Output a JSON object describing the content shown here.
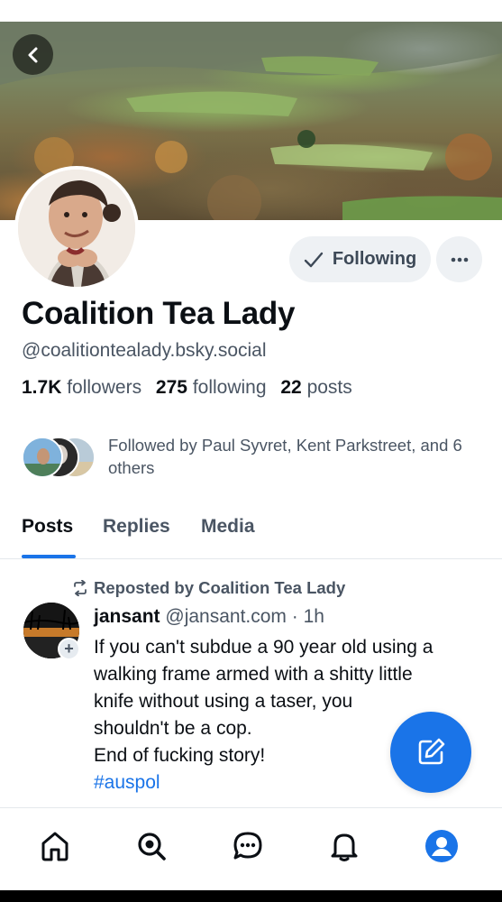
{
  "profile": {
    "display_name": "Coalition Tea Lady",
    "handle": "@coalitiontealady.bsky.social",
    "followers_count": "1.7K",
    "followers_label": "followers",
    "following_count": "275",
    "following_label": "following",
    "posts_count": "22",
    "posts_label": "posts",
    "following_button_label": "Following",
    "followed_by_text": "Followed by Paul Syvret, Kent Parkstreet, and 6 others"
  },
  "tabs": [
    {
      "label": "Posts",
      "active": true
    },
    {
      "label": "Replies",
      "active": false
    },
    {
      "label": "Media",
      "active": false
    }
  ],
  "feed": [
    {
      "repost_label": "Reposted by Coalition Tea Lady",
      "author": "jansant",
      "handle": "@jansant.com",
      "separator": "·",
      "time": "1h",
      "body_lines": [
        "If you can't subdue a 90 year old using a",
        "walking frame armed with a shitty little",
        "knife without using a taser, you",
        "shouldn't be a cop.",
        "End of fucking story!"
      ],
      "hashtag": "#auspol"
    }
  ],
  "bottom_nav": [
    {
      "name": "home",
      "icon": "home-icon"
    },
    {
      "name": "search",
      "icon": "search-icon"
    },
    {
      "name": "chat",
      "icon": "chat-icon"
    },
    {
      "name": "notifications",
      "icon": "bell-icon"
    },
    {
      "name": "profile",
      "icon": "profile-icon",
      "active": true
    }
  ],
  "colors": {
    "accent": "#1a74e8",
    "text_primary": "#0b0f14",
    "text_secondary": "#4a5563",
    "button_bg": "#eef1f4"
  }
}
